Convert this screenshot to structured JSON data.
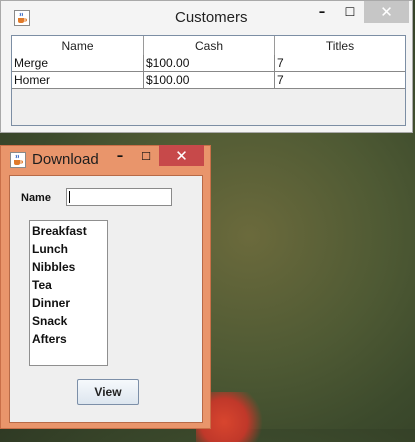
{
  "customers_window": {
    "title": "Customers",
    "minimize_symbol": "–",
    "maximize_symbol": "☐",
    "close_symbol": "✕",
    "table": {
      "columns": [
        "Name",
        "Cash",
        "Titles"
      ],
      "rows": [
        [
          "Merge",
          "$100.00",
          "7"
        ],
        [
          "Homer",
          "$100.00",
          "7"
        ]
      ]
    }
  },
  "download_window": {
    "title": "Download",
    "minimize_symbol": "–",
    "maximize_symbol": "☐",
    "close_symbol": "✕",
    "name_label": "Name",
    "name_value": "",
    "meals": [
      "Breakfast",
      "Lunch",
      "Nibbles",
      "Tea",
      "Dinner",
      "Snack",
      "Afters"
    ],
    "view_button": "View"
  },
  "icons": {
    "app_icon": "java-coffee-cup-icon"
  },
  "colors": {
    "download_frame": "#e9956b",
    "close_active": "#c7494a",
    "close_inactive": "#c6c6c6"
  }
}
